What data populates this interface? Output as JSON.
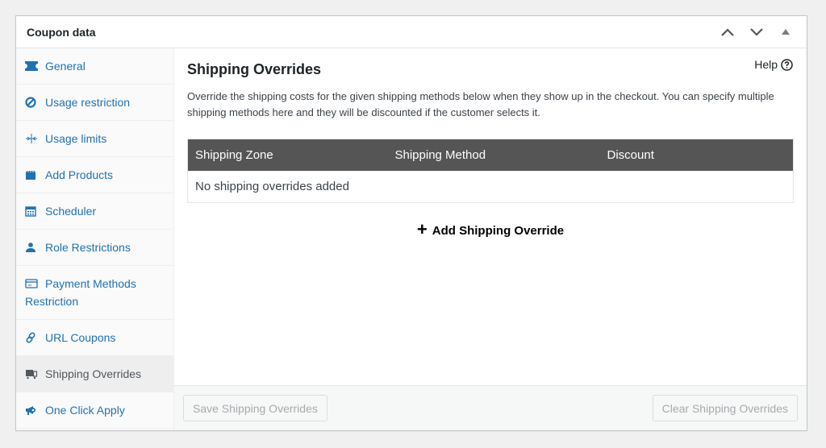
{
  "box": {
    "title": "Coupon data",
    "controls": [
      {
        "name": "move-up",
        "icon": "chevron-up-icon"
      },
      {
        "name": "move-down",
        "icon": "chevron-down-icon"
      },
      {
        "name": "toggle-panel",
        "icon": "triangle-up-icon"
      }
    ]
  },
  "tabs": [
    {
      "label": "General",
      "icon": "ticket-icon",
      "active": false
    },
    {
      "label": "Usage restriction",
      "icon": "no-entry-icon",
      "active": false
    },
    {
      "label": "Usage limits",
      "icon": "limits-icon",
      "active": false
    },
    {
      "label": "Add Products",
      "icon": "bag-icon",
      "active": false
    },
    {
      "label": "Scheduler",
      "icon": "calendar-icon",
      "active": false
    },
    {
      "label": "Role Restrictions",
      "icon": "user-icon",
      "active": false
    },
    {
      "label": "Payment Methods Restriction",
      "icon": "credit-card-icon",
      "active": false
    },
    {
      "label": "URL Coupons",
      "icon": "link-icon",
      "active": false
    },
    {
      "label": "Shipping Overrides",
      "icon": "truck-icon",
      "active": true
    },
    {
      "label": "One Click Apply",
      "icon": "megaphone-icon",
      "active": false
    }
  ],
  "panel": {
    "title": "Shipping Overrides",
    "help_label": "Help",
    "description": "Override the shipping costs for the given shipping methods below when they show up in the checkout. You can specify multiple shipping methods here and they will be discounted if the customer selects it.",
    "table": {
      "columns": [
        "Shipping Zone",
        "Shipping Method",
        "Discount"
      ],
      "empty_text": "No shipping overrides added"
    },
    "add_label": "Add Shipping Override",
    "save_label": "Save Shipping Overrides",
    "clear_label": "Clear Shipping Overrides"
  },
  "colors": {
    "link": "#2271b1",
    "table_header": "#555555",
    "active_tab_bg": "#eeeeee"
  }
}
